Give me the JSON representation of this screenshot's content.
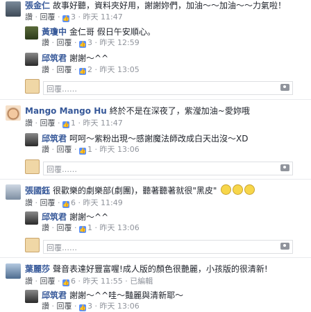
{
  "c1": {
    "name": "張金仁",
    "text": "故事好聽，資料夾好用，謝謝妳們，加油～～加油～～力氣啦！",
    "like": "讚",
    "reply": "回覆",
    "count": "3",
    "time": "昨天 11:47"
  },
  "r1a": {
    "name": "黃瓊中",
    "text": "金仁哥 假日午安順心。",
    "like": "讚",
    "reply": "回覆",
    "count": "3",
    "time": "昨天 12:59"
  },
  "r1b": {
    "name": "邱筑君",
    "text": "謝謝～^^",
    "like": "讚",
    "reply": "回覆",
    "count": "2",
    "time": "昨天 13:05"
  },
  "c2": {
    "name": "Mango Mango Hu",
    "text": "終於不是在深夜了，紫瀅加油~愛妳哦",
    "like": "讚",
    "reply": "回覆",
    "count": "1",
    "time": "昨天 11:47"
  },
  "r2a": {
    "name": "邱筑君",
    "text": "呵呵～紫粉出現～感謝魔法師改成白天出沒～XD",
    "like": "讚",
    "reply": "回覆",
    "count": "1",
    "time": "昨天 13:06"
  },
  "c3": {
    "name": "張國鈺",
    "text": "很歡樂的劇樂部(劇團)，聽著聽著就很\"黑皮\"",
    "like": "讚",
    "reply": "回覆",
    "count": "6",
    "time": "昨天 11:49"
  },
  "r3a": {
    "name": "邱筑君",
    "text": "謝謝～^^",
    "like": "讚",
    "reply": "回覆",
    "count": "1",
    "time": "昨天 13:06"
  },
  "c4": {
    "name": "葉麗莎",
    "text": "聲音表達好豐富喔!成人版的顏色很艷麗，小孩版的很清新!",
    "like": "讚",
    "reply": "回覆",
    "count": "6",
    "time": "昨天 11:55",
    "edited": "已編輯"
  },
  "r4a": {
    "name": "邱筑君",
    "text": "謝謝～^^哇～豔麗與清新耶～",
    "like": "讚",
    "reply": "回覆",
    "count": "3",
    "time": "昨天 13:06"
  },
  "reply_placeholder": "回覆……",
  "icons": {
    "camera": "camera-icon",
    "like": "thumbs-up-icon",
    "emoji": "smile-emoji-icon"
  },
  "colors": {
    "link": "#365899",
    "meta": "#90949c",
    "like": "#5890ff"
  }
}
